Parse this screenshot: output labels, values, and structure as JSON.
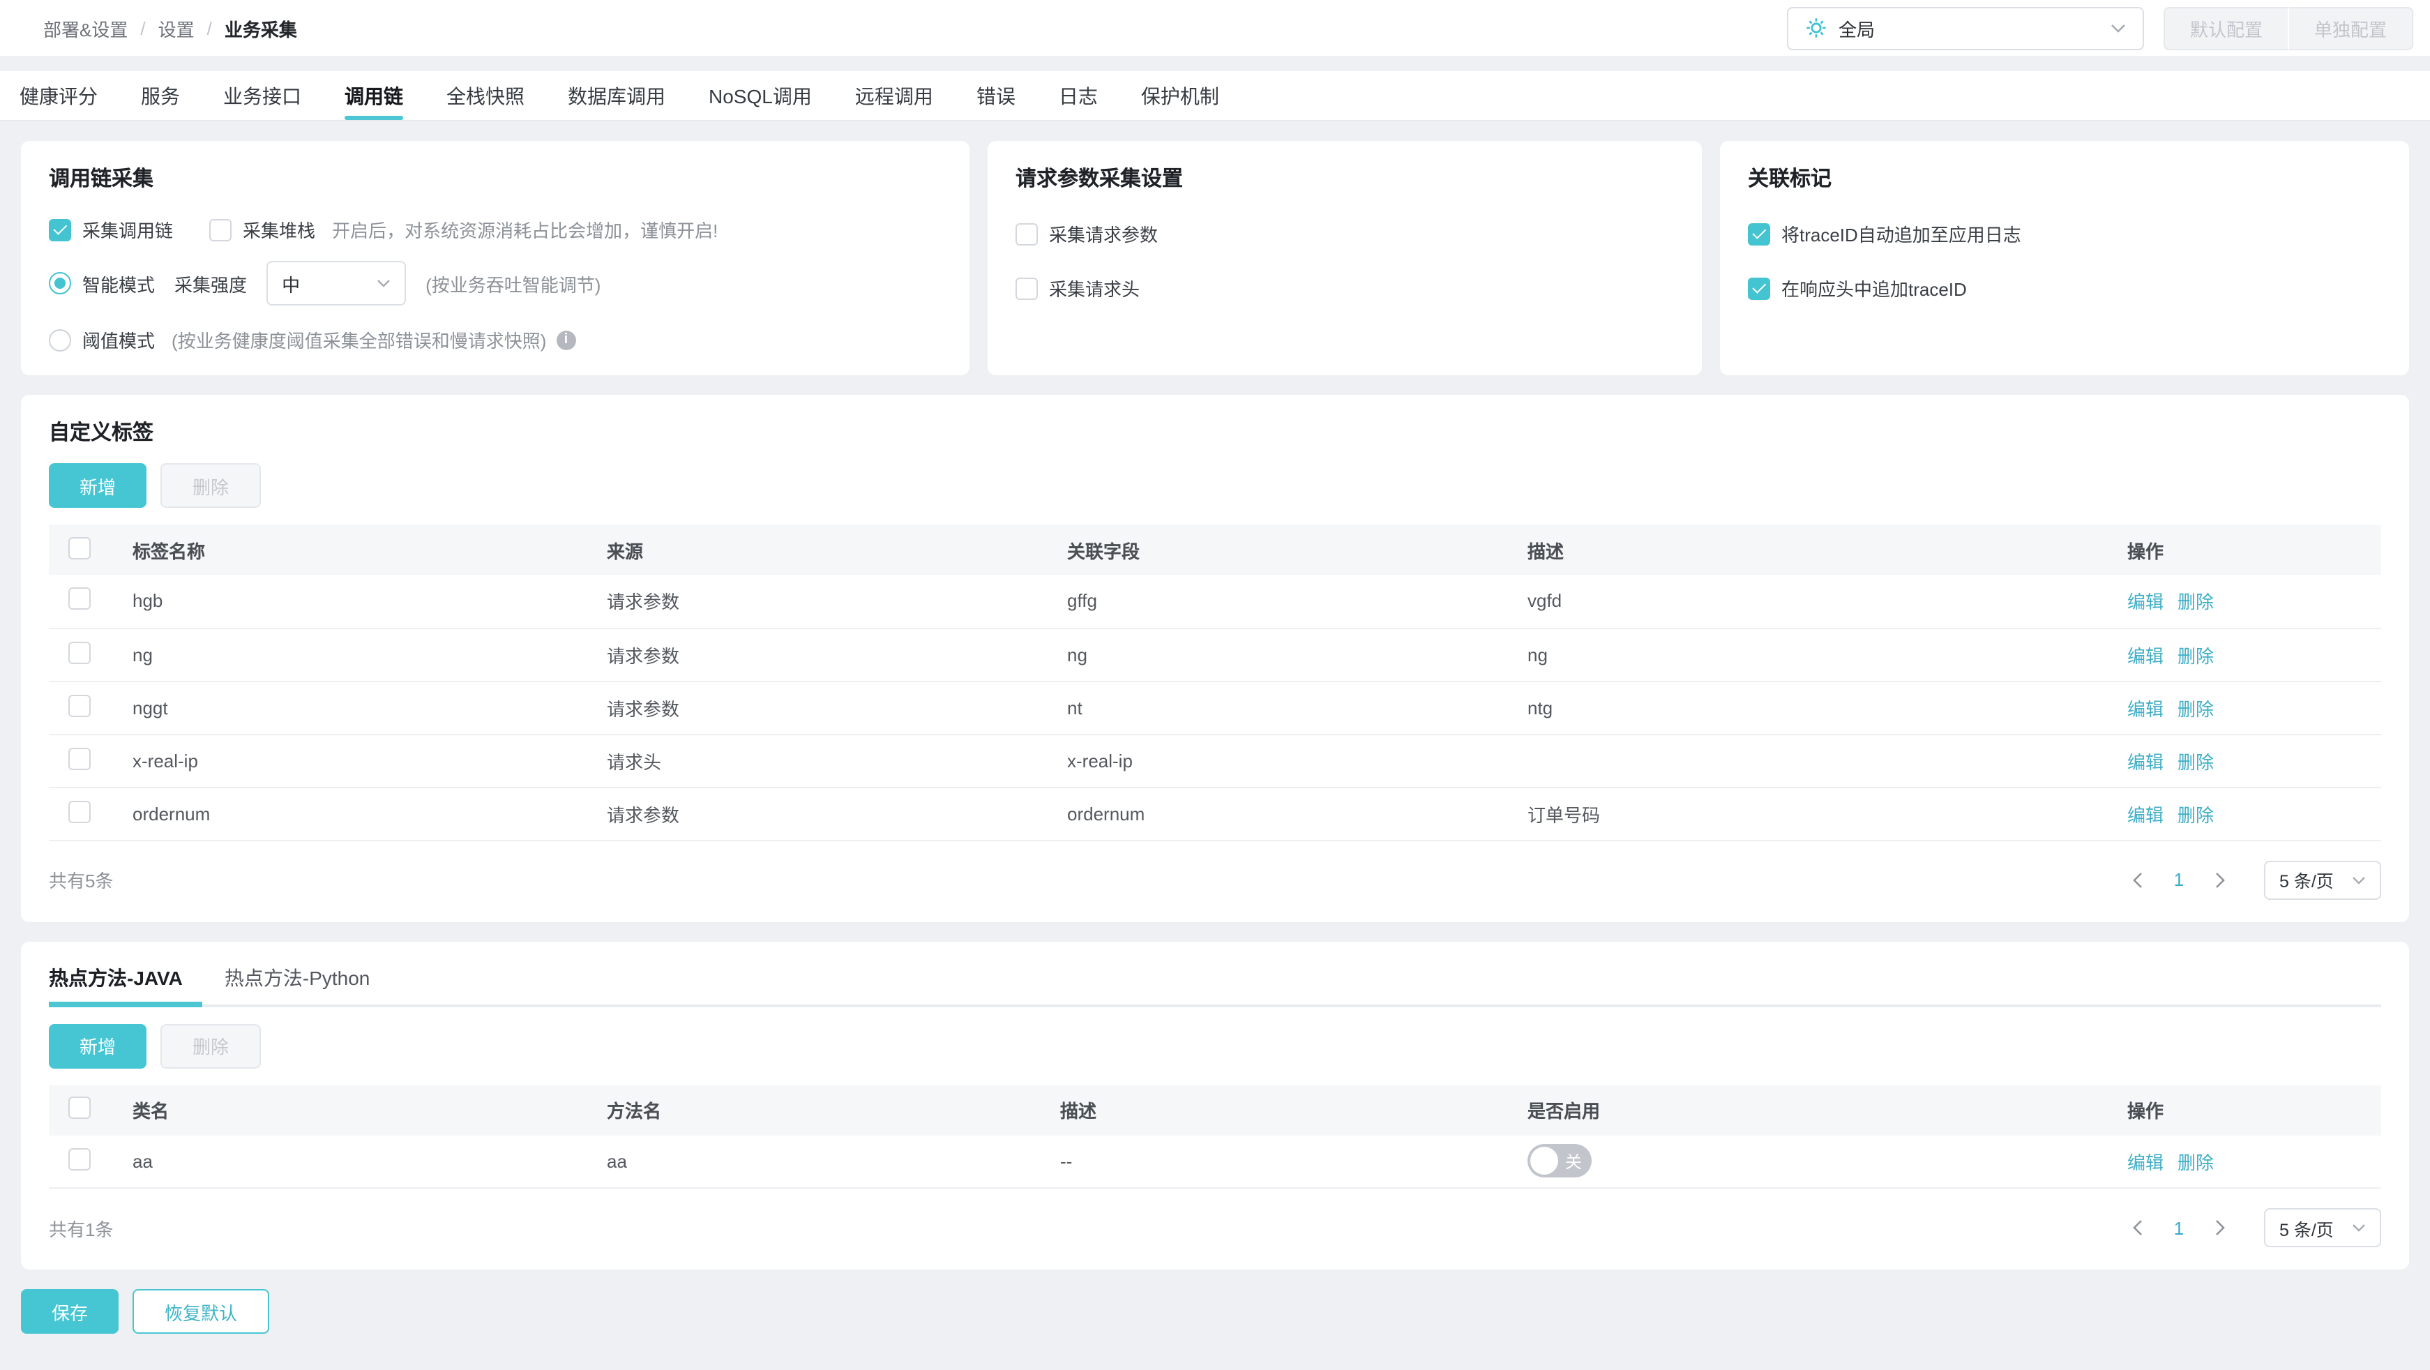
{
  "accent_color": "#46c6d3",
  "link_color": "#40aec6",
  "breadcrumb": {
    "items": [
      "部署&设置",
      "设置",
      "业务采集"
    ],
    "separator": "/"
  },
  "header_right": {
    "scope_value": "全局",
    "config_buttons": [
      "默认配置",
      "单独配置"
    ]
  },
  "tabs": {
    "items": [
      "健康评分",
      "服务",
      "业务接口",
      "调用链",
      "全栈快照",
      "数据库调用",
      "NoSQL调用",
      "远程调用",
      "错误",
      "日志",
      "保护机制"
    ],
    "active": "调用链"
  },
  "trace_card": {
    "title": "调用链采集",
    "collect_trace_label": "采集调用链",
    "collect_trace_checked": true,
    "collect_stack_label": "采集堆栈",
    "collect_stack_checked": false,
    "stack_hint": "开启后，对系统资源消耗占比会增加，谨慎开启!",
    "smart_mode_label": "智能模式",
    "smart_mode_selected": true,
    "strength_label": "采集强度",
    "strength_value": "中",
    "smart_hint": "(按业务吞吐智能调节)",
    "threshold_label": "阈值模式",
    "threshold_selected": false,
    "threshold_hint": "(按业务健康度阈值采集全部错误和慢请求快照)"
  },
  "request_card": {
    "title": "请求参数采集设置",
    "options": [
      {
        "label": "采集请求参数",
        "checked": false
      },
      {
        "label": "采集请求头",
        "checked": false
      }
    ]
  },
  "mark_card": {
    "title": "关联标记",
    "options": [
      {
        "label": "将traceID自动追加至应用日志",
        "checked": true
      },
      {
        "label": "在响应头中追加traceID",
        "checked": true
      }
    ]
  },
  "custom_tags": {
    "title": "自定义标签",
    "add_label": "新增",
    "delete_label": "删除",
    "columns": [
      "标签名称",
      "来源",
      "关联字段",
      "描述",
      "操作"
    ],
    "rows": [
      {
        "name": "hgb",
        "source": "请求参数",
        "field": "gffg",
        "desc": "vgfd"
      },
      {
        "name": "ng",
        "source": "请求参数",
        "field": "ng",
        "desc": "ng"
      },
      {
        "name": "nggt",
        "source": "请求参数",
        "field": "nt",
        "desc": "ntg"
      },
      {
        "name": "x-real-ip",
        "source": "请求头",
        "field": "x-real-ip",
        "desc": ""
      },
      {
        "name": "ordernum",
        "source": "请求参数",
        "field": "ordernum",
        "desc": "订单号码"
      }
    ],
    "edit_label": "编辑",
    "delete_link_label": "删除",
    "total_text": "共有5条",
    "current_page": "1",
    "page_size": "5 条/页"
  },
  "hot_methods": {
    "tabs": [
      "热点方法-JAVA",
      "热点方法-Python"
    ],
    "active_tab": "热点方法-JAVA",
    "add_label": "新增",
    "delete_label": "删除",
    "columns": [
      "类名",
      "方法名",
      "描述",
      "是否启用",
      "操作"
    ],
    "rows": [
      {
        "class_name": "aa",
        "method_name": "aa",
        "desc": "--",
        "enabled": false,
        "toggle_label": "关"
      }
    ],
    "edit_label": "编辑",
    "delete_link_label": "删除",
    "total_text": "共有1条",
    "current_page": "1",
    "page_size": "5 条/页"
  },
  "footer_actions": {
    "save_label": "保存",
    "reset_label": "恢复默认"
  }
}
